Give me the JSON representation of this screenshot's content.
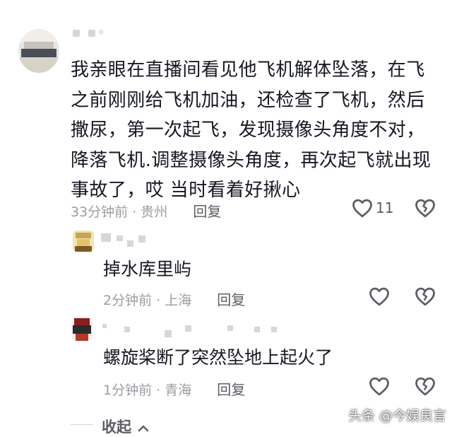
{
  "comments": [
    {
      "text": "我亲眼在直播间看见他飞机解体坠落，在飞之前刚刚给飞机加油，还检查了飞机，然后撒尿，第一次起飞，发现摄像头角度不对，降落飞机.调整摄像头角度，再次起飞就出现事故了，哎  当时看着好揪心",
      "time_location": "33分钟前 · 贵州",
      "reply_label": "回复",
      "like_count": "11"
    },
    {
      "text": "掉水库里屿",
      "time_location": "2分钟前 · 上海",
      "reply_label": "回复"
    },
    {
      "text": "螺旋桨断了突然坠地上起火了",
      "time_location": "1分钟前 · 青海",
      "reply_label": "回复"
    }
  ],
  "collapse_label": "收起",
  "watermark": "头条 @今娱良言",
  "icons": {
    "like": "heart-outline-icon",
    "dislike": "broken-heart-icon",
    "collapse": "chevron-up-icon"
  },
  "colors": {
    "text": "#161823",
    "meta": "#9b9ca1",
    "icon": "#5c5d64"
  }
}
